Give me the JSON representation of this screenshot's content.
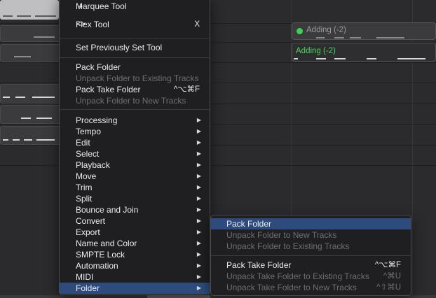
{
  "main_menu": {
    "tools": [
      {
        "icon": "crosshair-icon",
        "glyph": "+",
        "label": "Marquee Tool",
        "shortcut": ""
      },
      {
        "icon": "flex-icon",
        "glyph": "<>",
        "label": "Flex Tool",
        "shortcut": "X"
      }
    ],
    "set_previous": "Set Previously Set Tool",
    "folder_items": [
      {
        "label": "Pack Folder",
        "shortcut": "",
        "enabled": true
      },
      {
        "label": "Unpack Folder to Existing Tracks",
        "shortcut": "",
        "enabled": false
      },
      {
        "label": "Pack Take Folder",
        "shortcut": "^⌥⌘F",
        "enabled": true
      },
      {
        "label": "Unpack Folder to New Tracks",
        "shortcut": "",
        "enabled": false
      }
    ],
    "submenus": [
      "Processing",
      "Tempo",
      "Edit",
      "Select",
      "Playback",
      "Move",
      "Trim",
      "Split",
      "Bounce and Join",
      "Convert",
      "Export",
      "Name and Color",
      "SMPTE Lock",
      "Automation",
      "MIDI",
      "Folder"
    ],
    "highlighted": "Folder",
    "arrow_glyph": "▶"
  },
  "folder_submenu": {
    "items": [
      {
        "label": "Pack Folder",
        "shortcut": "",
        "enabled": true,
        "highlighted": true
      },
      {
        "label": "Unpack Folder to New Tracks",
        "shortcut": "",
        "enabled": false
      },
      {
        "label": "Unpack Folder to Existing Tracks",
        "shortcut": "",
        "enabled": false
      }
    ],
    "take_items": [
      {
        "label": "Pack Take Folder",
        "shortcut": "^⌥⌘F",
        "enabled": true
      },
      {
        "label": "Unpack Take Folder to Existing Tracks",
        "shortcut": "^⌘U",
        "enabled": false
      },
      {
        "label": "Unpack Take Folder to New Tracks",
        "shortcut": "^⇧⌘U",
        "enabled": false
      }
    ]
  },
  "regions": [
    {
      "label": "Adding (-2)",
      "style": "collapsed",
      "dot_color": "#3fcf55"
    },
    {
      "label": "Adding (-2)",
      "style": "open",
      "text_color": "#4fd35f"
    }
  ],
  "colors": {
    "highlight": "#2e4b7e",
    "menu_bg": "#1f1f21",
    "disabled_text": "#6e6e73"
  }
}
